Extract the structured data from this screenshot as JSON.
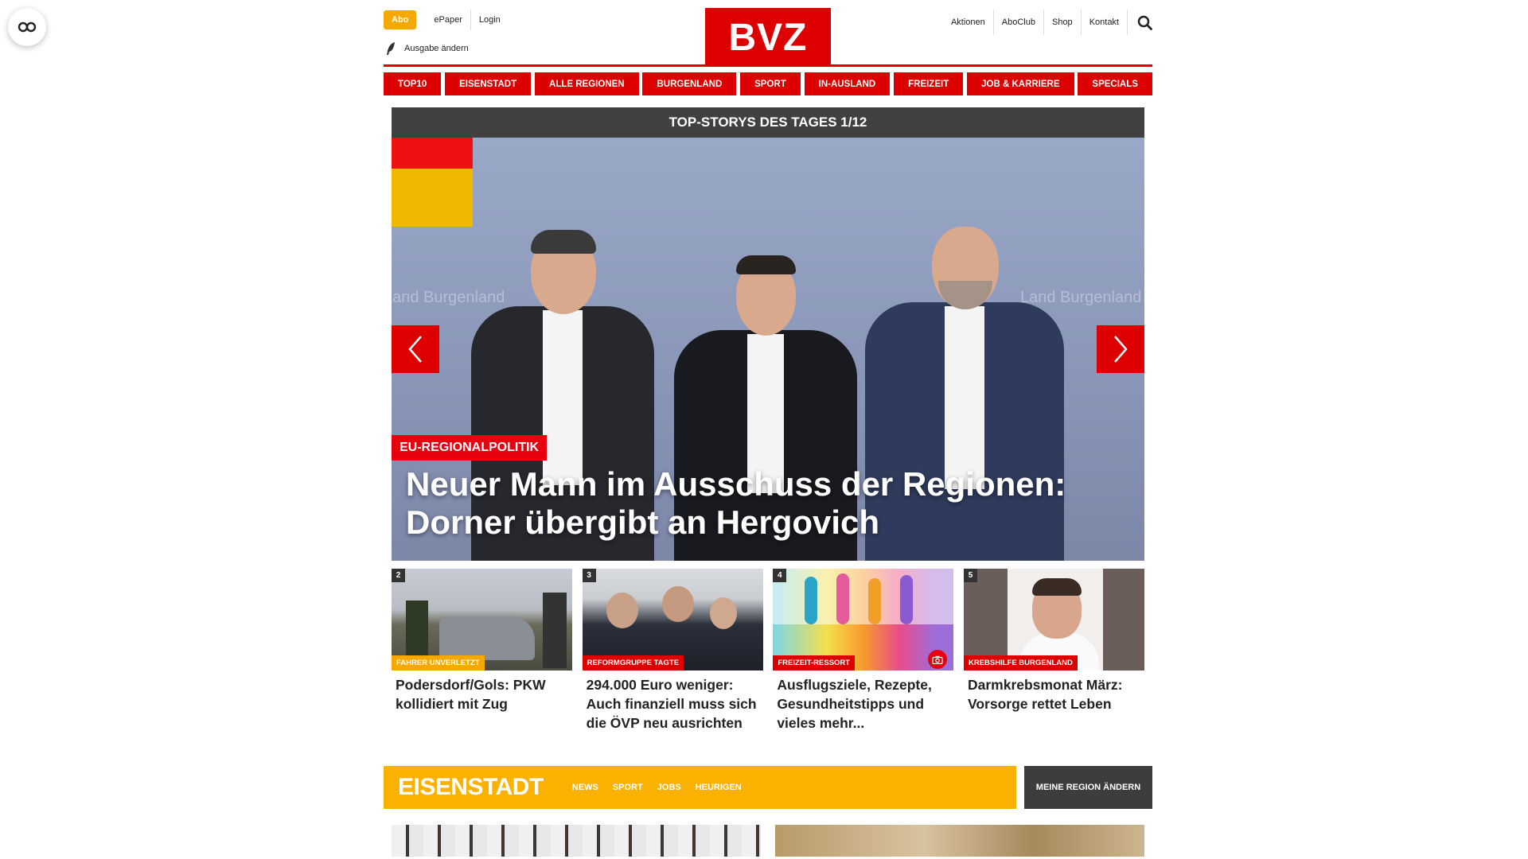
{
  "header": {
    "abo_label": "Abo",
    "epaper_label": "ePaper",
    "login_label": "Login",
    "ausgabe_label": "Ausgabe ändern",
    "logo_text": "BVZ",
    "right_links": [
      "Aktionen",
      "AboClub",
      "Shop",
      "Kontakt"
    ]
  },
  "nav": {
    "items": [
      "TOP10",
      "EISENSTADT",
      "ALLE REGIONEN",
      "BURGENLAND",
      "SPORT",
      "IN-AUSLAND",
      "FREIZEIT",
      "JOB & KARRIERE",
      "SPECIALS"
    ]
  },
  "top_stories": {
    "heading": "TOP-STORYS DES TAGES 1/12",
    "category": "EU-REGIONALPOLITIK",
    "title": "Neuer Mann im Ausschuss der Regionen: Dorner übergibt an Hergovich",
    "wall_text": "Land Burgenland"
  },
  "cards": [
    {
      "number": "2",
      "category": "FAHRER UNVERLETZT",
      "title": "Podersdorf/Gols: PKW kollidiert mit Zug"
    },
    {
      "number": "3",
      "category": "REFORMGRUPPE TAGTE",
      "title": "294.000 Euro weniger: Auch finanziell muss sich die ÖVP neu ausrichten"
    },
    {
      "number": "4",
      "category": "FREIZEIT-RESSORT",
      "title": "Ausflugsziele, Rezepte, Gesundheitstipps und vieles mehr..."
    },
    {
      "number": "5",
      "category": "KREBSHILFE BURGENLAND",
      "title": "Darmkrebsmonat März: Vorsorge rettet Leben"
    }
  ],
  "region": {
    "name": "EISENSTADT",
    "links": [
      "NEWS",
      "SPORT",
      "JOBS",
      "HEURIGEN"
    ],
    "change_label": "MEINE REGION ÄNDERN"
  },
  "colors": {
    "brand_red": "#dd0000",
    "region_yellow": "#fbb100",
    "abo_orange": "#f5a800"
  }
}
